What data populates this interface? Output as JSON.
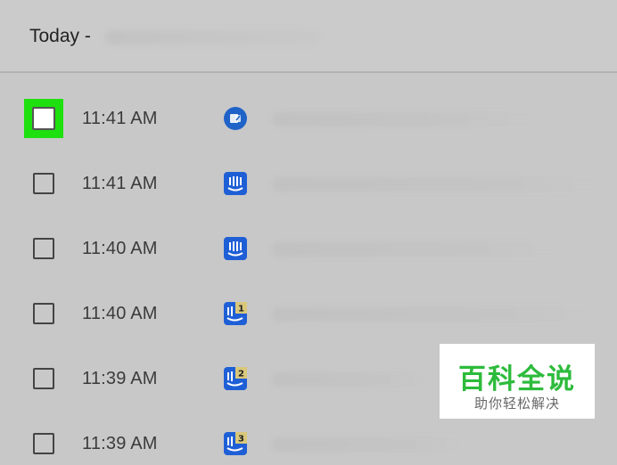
{
  "header": {
    "title": "Today -"
  },
  "rows": [
    {
      "time": "11:41 AM",
      "icon": "outlook-calendar-icon",
      "selected_highlight": true
    },
    {
      "time": "11:41 AM",
      "icon": "intercom-icon",
      "badge": ""
    },
    {
      "time": "11:40 AM",
      "icon": "intercom-icon",
      "badge": ""
    },
    {
      "time": "11:40 AM",
      "icon": "intercom-badge-icon",
      "badge": "1"
    },
    {
      "time": "11:39 AM",
      "icon": "intercom-badge-icon",
      "badge": "2"
    },
    {
      "time": "11:39 AM",
      "icon": "intercom-badge-icon",
      "badge": "3"
    }
  ],
  "watermark": {
    "main": "百科全说",
    "sub": "助你轻松解决"
  },
  "colors": {
    "highlight": "#1ee00f",
    "icon_blue": "#1f5fd6",
    "watermark_green": "#2dbb3c"
  }
}
